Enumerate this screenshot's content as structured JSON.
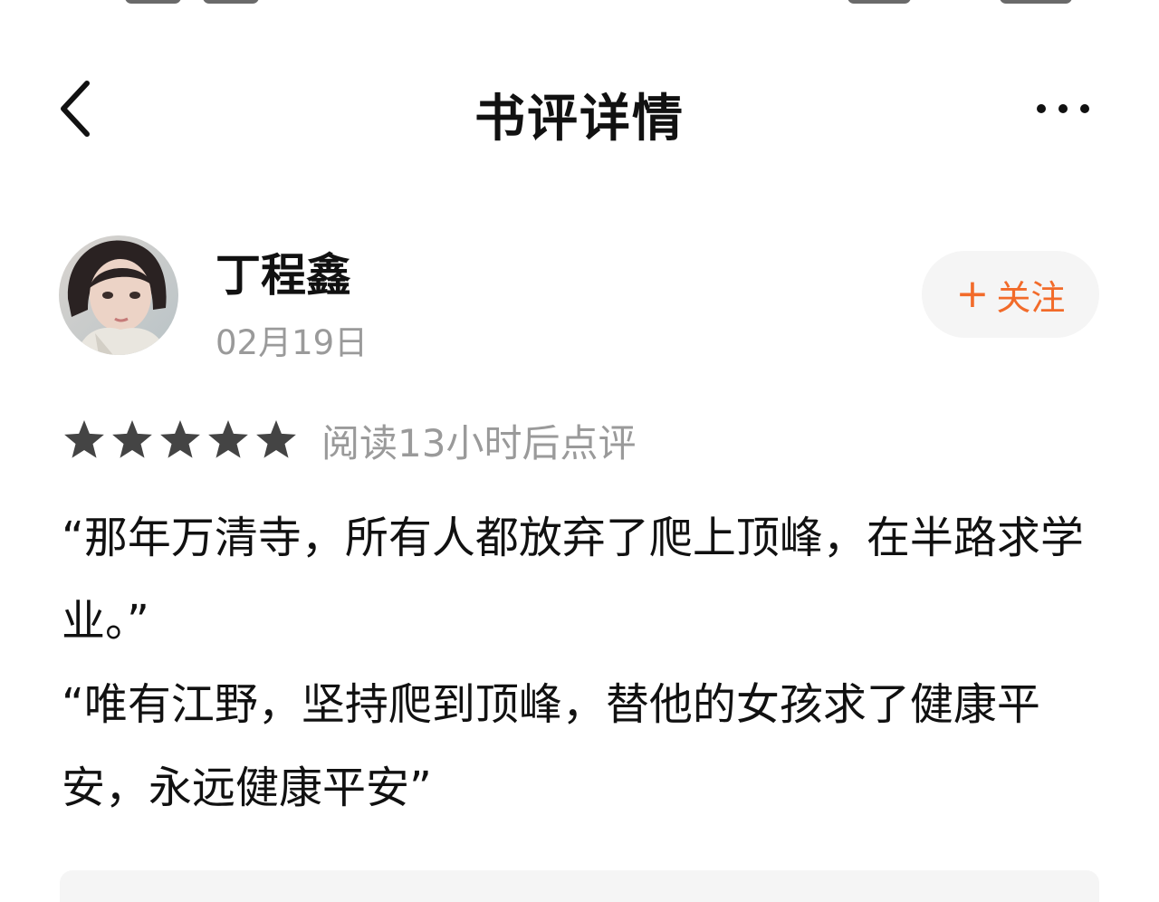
{
  "header": {
    "title": "书评详情"
  },
  "reviewer": {
    "name": "丁程鑫",
    "date": "02月19日"
  },
  "follow": {
    "plus": "+",
    "label": "关注"
  },
  "rating": {
    "stars": 5,
    "max_stars": 5,
    "note": "阅读13小时后点评"
  },
  "review": {
    "paragraphs": [
      "“那年万清寺，所有人都放弃了爬上顶峰，在半路求学业。”",
      "“唯有江野，坚持爬到顶峰，替他的女孩求了健康平安，永远健康平安”"
    ]
  },
  "icons": {
    "back": "chevron-left-icon",
    "more": "more-horizontal-icon",
    "star": "star-icon"
  },
  "colors": {
    "accent": "#f26b2a",
    "star": "#444444",
    "muted_text": "#9a9a9a",
    "follow_bg": "#f5f5f5"
  }
}
